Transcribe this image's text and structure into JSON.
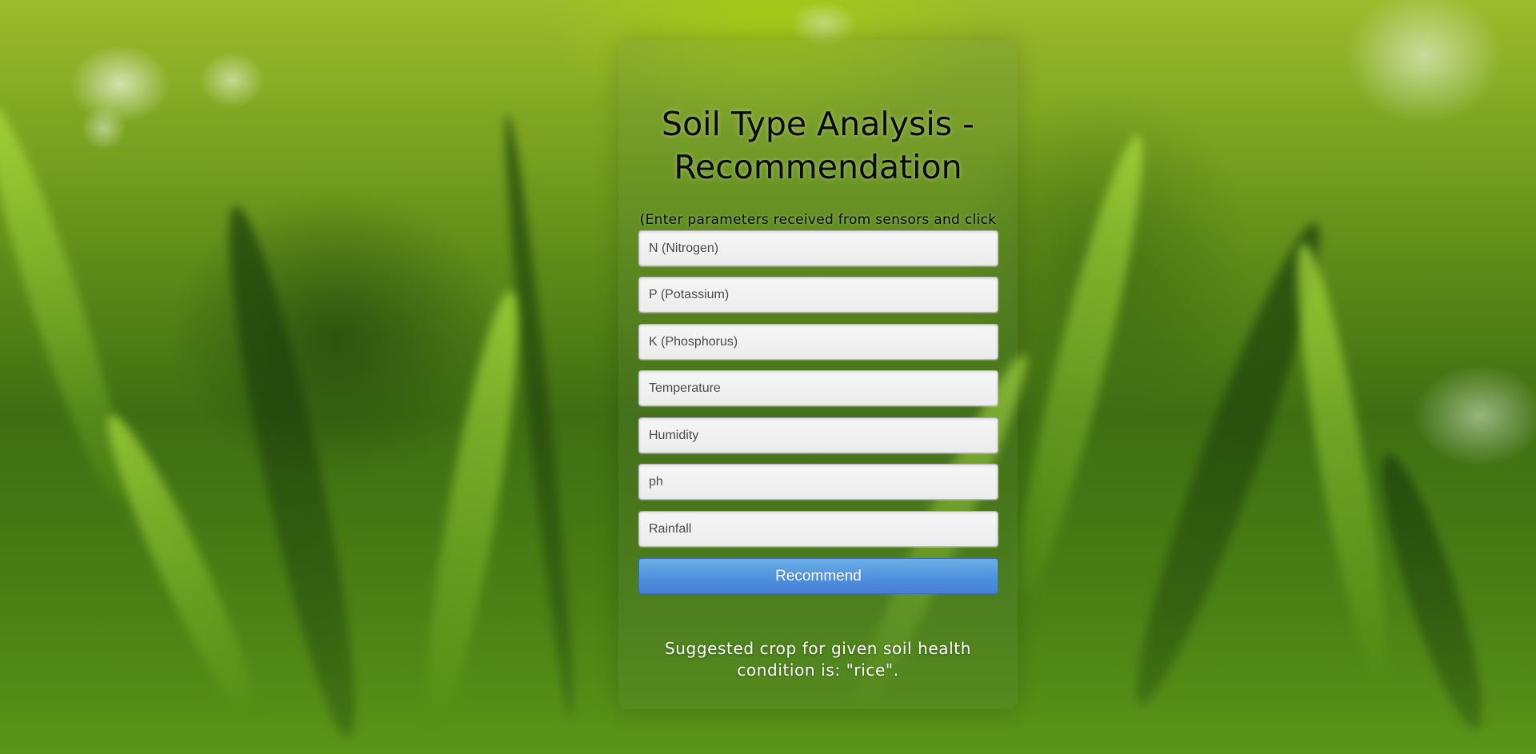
{
  "page": {
    "title": "Soil Type Analysis - Recommendation",
    "subtitle": "(Enter parameters received from sensors and click Recommend to get the result.)"
  },
  "form": {
    "fields": [
      {
        "name": "nitrogen",
        "placeholder": "N (Nitrogen)",
        "value": ""
      },
      {
        "name": "potassium",
        "placeholder": "P (Potassium)",
        "value": ""
      },
      {
        "name": "phosphorus",
        "placeholder": "K (Phosphorus)",
        "value": ""
      },
      {
        "name": "temperature",
        "placeholder": "Temperature",
        "value": ""
      },
      {
        "name": "humidity",
        "placeholder": "Humidity",
        "value": ""
      },
      {
        "name": "ph",
        "placeholder": "ph",
        "value": ""
      },
      {
        "name": "rainfall",
        "placeholder": "Rainfall",
        "value": ""
      }
    ],
    "submit_label": "Recommend"
  },
  "result": {
    "text": "Suggested crop for given soil health condition is: \"rice\"."
  },
  "colors": {
    "button_top": "#6bb0e6",
    "button_bottom": "#4a7fd6",
    "title_text": "#0a0a0a",
    "result_text": "#ffffff"
  }
}
